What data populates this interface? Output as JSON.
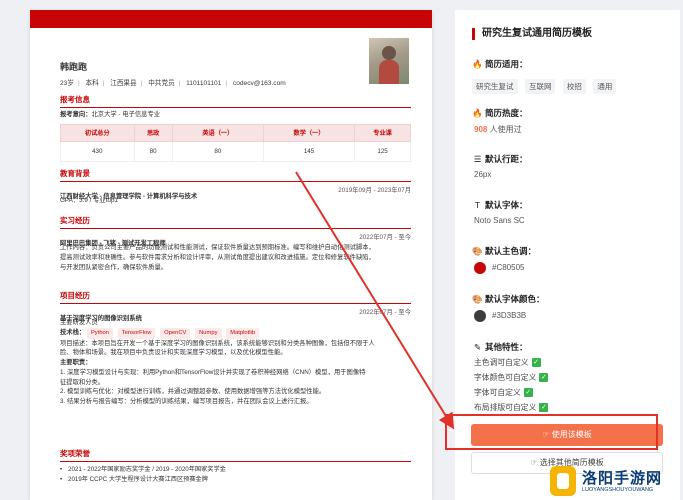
{
  "resume": {
    "name": "韩跑跑",
    "info": [
      "23岁",
      "本科",
      "江西果县",
      "中共党员",
      "1101101101",
      "codecv@163.com"
    ],
    "sections": {
      "apply": {
        "title": "报考信息",
        "direction_label": "报考意向：",
        "direction_value": "北京大学 - 电子信息专业",
        "headers": [
          "初试总分",
          "思政",
          "英语（一）",
          "数学（一）",
          "专业课"
        ],
        "values": [
          "430",
          "80",
          "80",
          "145",
          "125"
        ]
      },
      "education": {
        "title": "教育背景",
        "school": "江西财经大学 - 信息管理学院 - 计算机科学与技术",
        "date": "2019年09月 - 2023年07月",
        "gpa": "GPA：3.9 / 专业top1"
      },
      "internship": {
        "title": "实习经历",
        "company": "阿里巴巴集团 - 飞猪 - 测试开发工程师",
        "date": "2022年07月 - 至今",
        "lines": [
          "工作内容：负责公司主要产品的功能测试和性能测试，保证软件质量达到预期标准。编写和维护自动化测试脚本，",
          "提高测试效率和准确性。参与软件需求分析和设计评审，从测试角度提出建议和改进措施。定位和修复软件缺陷，",
          "与开发团队紧密合作，确保软件质量。"
        ]
      },
      "project": {
        "title": "项目经历",
        "name": "基于深度学习的图像识别系统",
        "date": "2022年07月 - 至今",
        "role": "主要研发人员",
        "tech_label": "技术栈：",
        "tech": [
          "Python",
          "TensorFlow",
          "OpenCV",
          "Numpy",
          "Matplotlib"
        ],
        "desc": [
          "项目描述：本项目旨在开发一个基于深度学习的图像识别系统，该系统能够识别和分类各种图像，包括但不限于人",
          "脸、物体和场景。我在项目中负责设计和实现深度学习模型，以及优化模型性能。"
        ],
        "duty_label": "主要职责：",
        "duties": [
          "1. 深度学习模型设计与实现：利用Python和TensorFlow设计并实现了卷积神经网络（CNN）模型，用于图像特",
          "    征提取和分类。",
          "2. 模型训练与优化：对模型进行训练，并通过调整超参数、使用数据增强等方法优化模型性能。",
          "3. 结果分析与报告编写：分析模型的训练结果，编写项目报告，并在团队会议上进行汇报。"
        ]
      },
      "awards": {
        "title": "奖项荣誉",
        "items": [
          "2021 - 2022年国家励志奖学金 / 2019 - 2020年国家奖学金",
          "2019年 CCPC 大学生程序设计大赛江西区预赛金牌"
        ]
      }
    }
  },
  "panel": {
    "title": "研究生复试通用简历模板",
    "use_label": "简历适用：",
    "tags": [
      "研究生复试",
      "互联网",
      "校招",
      "通用"
    ],
    "heat_label": "简历热度：",
    "heat_count": "908",
    "heat_suffix": " 人使用过",
    "lineheight_label": "默认行距：",
    "lineheight_value": "26px",
    "font_label": "默认字体：",
    "font_value": "Noto Sans SC",
    "theme_label": "默认主色调：",
    "theme_value": "#C80505",
    "fontcolor_label": "默认字体颜色：",
    "fontcolor_value": "#3D3B3B",
    "features_label": "其他特性：",
    "features": [
      "主色调可自定义",
      "字体颜色可自定义",
      "字体可自定义",
      "布局排版可自定义"
    ],
    "use_button": "使用该模板",
    "other_button": "选择其他简历模板"
  },
  "watermark": {
    "title": "洛阳手游网",
    "sub": "LUOYANGSHOUYOUWANG"
  },
  "colors": {
    "accent": "#c80505",
    "text": "#3d3b3b",
    "button": "#f57149"
  }
}
